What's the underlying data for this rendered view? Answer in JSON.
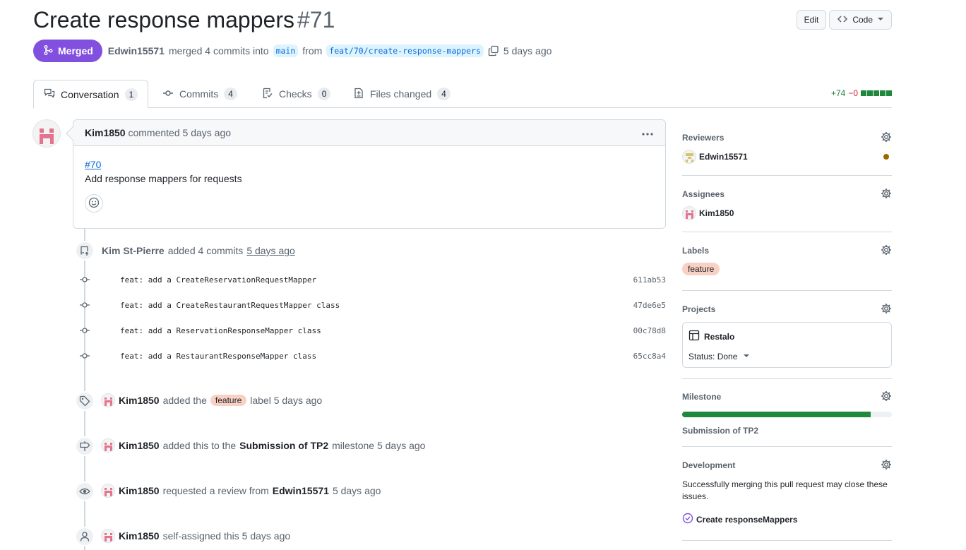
{
  "header": {
    "title": "Create response mappers",
    "number": "#71",
    "edit_label": "Edit",
    "code_label": "Code"
  },
  "meta": {
    "state": "Merged",
    "author": "Edwin15571",
    "action": "merged 4 commits into",
    "base_branch": "main",
    "from_text": "from",
    "head_branch": "feat/70/create-response-mappers",
    "time": "5 days ago"
  },
  "tabs": [
    {
      "label": "Conversation",
      "count": "1",
      "icon": "comment-discussion-icon"
    },
    {
      "label": "Commits",
      "count": "4",
      "icon": "git-commit-icon"
    },
    {
      "label": "Checks",
      "count": "0",
      "icon": "checklist-icon"
    },
    {
      "label": "Files changed",
      "count": "4",
      "icon": "file-diff-icon"
    }
  ],
  "diffstat": {
    "additions": "+74",
    "deletions": "−0"
  },
  "comment": {
    "author": "Kim1850",
    "action": "commented 5 days ago",
    "issue_link": "#70",
    "body": "Add response mappers for requests"
  },
  "commits_event": {
    "author": "Kim St-Pierre",
    "action": "added 4 commits",
    "time": "5 days ago",
    "commits": [
      {
        "message": "feat: add a CreateReservationRequestMapper",
        "sha": "611ab53"
      },
      {
        "message": "feat: add a CreateRestaurantRequestMapper class",
        "sha": "47de6e5"
      },
      {
        "message": "feat: add a ReservationResponseMapper class",
        "sha": "00c78d8"
      },
      {
        "message": "feat: add a RestaurantResponseMapper class",
        "sha": "65cc8a4"
      }
    ]
  },
  "events": {
    "label": {
      "user": "Kim1850",
      "pre": "added the",
      "label": "feature",
      "post": "label 5 days ago"
    },
    "milestone": {
      "user": "Kim1850",
      "pre": "added this to the",
      "milestone": "Submission of TP2",
      "post": "milestone 5 days ago"
    },
    "review": {
      "user": "Kim1850",
      "pre": "requested a review from",
      "reviewer": "Edwin15571",
      "post": "5 days ago"
    },
    "assign": {
      "user": "Kim1850",
      "text": "self-assigned this 5 days ago"
    }
  },
  "sidebar": {
    "reviewers": {
      "title": "Reviewers",
      "name": "Edwin15571",
      "status_color": "#9a6700"
    },
    "assignees": {
      "title": "Assignees",
      "name": "Kim1850"
    },
    "labels": {
      "title": "Labels",
      "label": "feature",
      "label_color": "#f9d0c4"
    },
    "projects": {
      "title": "Projects",
      "name": "Restalo",
      "status": "Status: Done"
    },
    "milestone": {
      "title": "Milestone",
      "name": "Submission of TP2",
      "progress": 0.9
    },
    "development": {
      "title": "Development",
      "text": "Successfully merging this pull request may close these issues.",
      "issue": "Create responseMappers"
    }
  },
  "colors": {
    "merged": "#8250df",
    "link": "#0969da",
    "success": "#1f883d"
  }
}
